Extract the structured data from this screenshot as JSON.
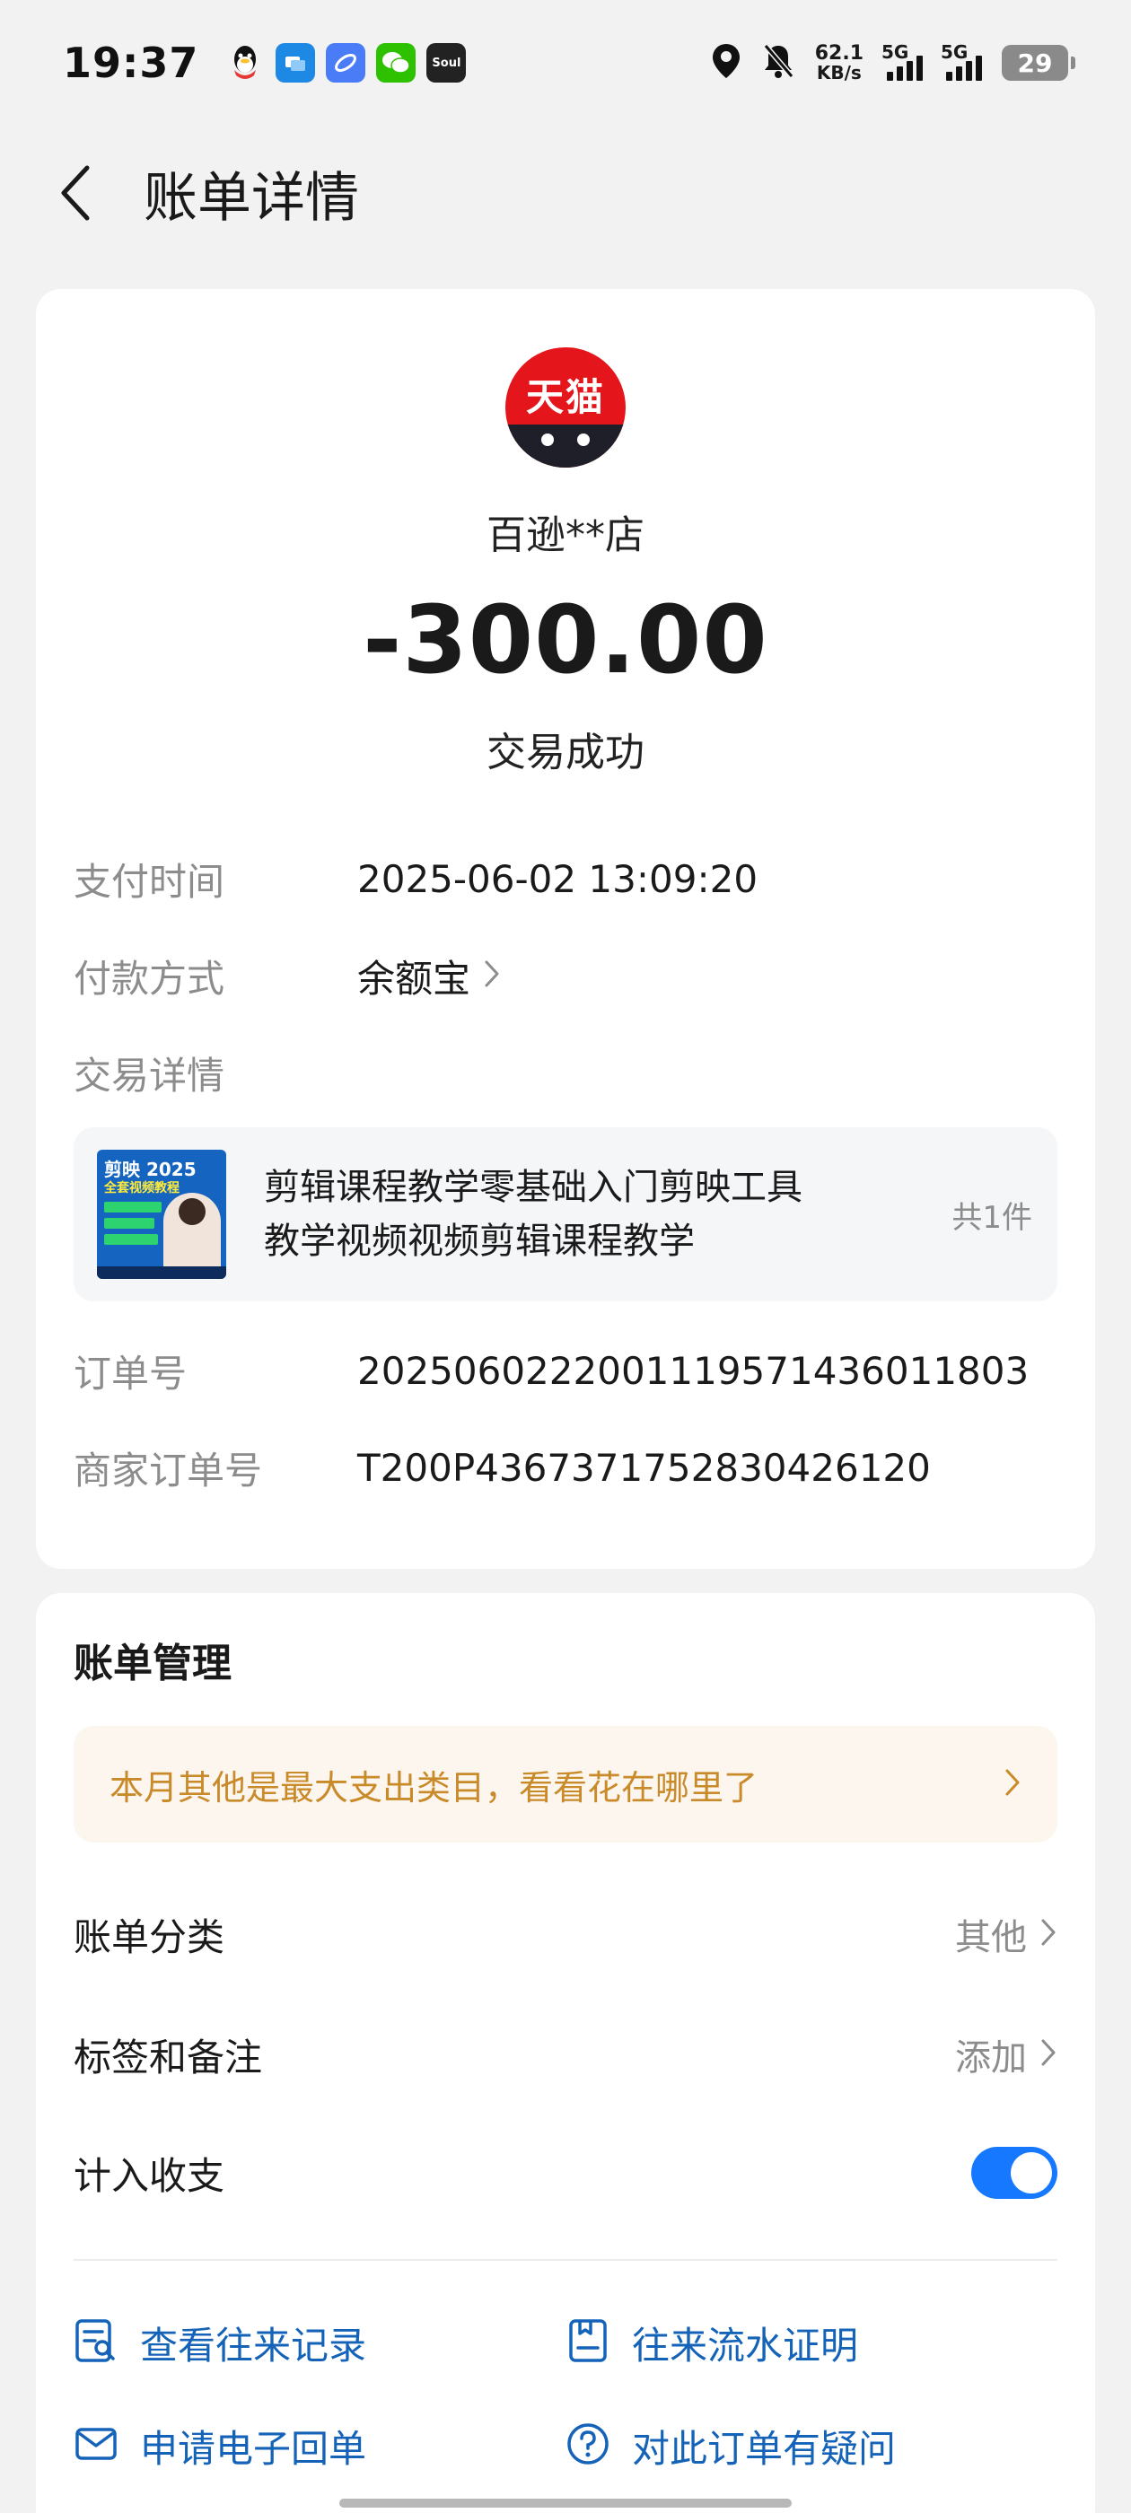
{
  "status_bar": {
    "time": "19:37",
    "net_speed_value": "62.1",
    "net_speed_unit": "KB/s",
    "sim1_label": "5G",
    "sim2_label": "5G",
    "battery": "29",
    "app_icons": [
      "qq-icon",
      "message-app-icon",
      "browser-app-icon",
      "wechat-icon",
      "soul-app-icon"
    ],
    "soul_label": "Soul"
  },
  "header": {
    "title": "账单详情"
  },
  "detail": {
    "merchant_logo_text": "天猫",
    "merchant_name": "百逊**店",
    "amount": "-300.00",
    "status": "交易成功",
    "rows": {
      "pay_time_label": "支付时间",
      "pay_time_value": "2025-06-02 13:09:20",
      "pay_method_label": "付款方式",
      "pay_method_value": "余额宝",
      "trade_detail_label": "交易详情",
      "order_no_label": "订单号",
      "order_no_value": "2025060222001119571436011803",
      "merchant_order_label": "商家订单号",
      "merchant_order_value": "T200P4367371752830426120"
    },
    "product": {
      "thumb_title": "剪映 2025",
      "thumb_subtitle": "全套视频教程",
      "title_line1": "剪辑课程教学零基础入门剪映工具",
      "title_line2": "教学视频视频剪辑课程教学",
      "count": "共1件"
    }
  },
  "manage": {
    "section_title": "账单管理",
    "tip": "本月其他是最大支出类目，看看花在哪里了",
    "category_label": "账单分类",
    "category_value": "其他",
    "tags_label": "标签和备注",
    "tags_value": "添加",
    "include_label": "计入收支",
    "include_on": true,
    "actions": {
      "history": "查看往来记录",
      "flow_proof": "往来流水证明",
      "e_receipt": "申请电子回单",
      "question": "对此订单有疑问"
    }
  },
  "colors": {
    "accent_blue": "#1677ff",
    "link_blue": "#1463b8",
    "tip_orange": "#c98a2a",
    "tmall_red": "#e4161b"
  }
}
